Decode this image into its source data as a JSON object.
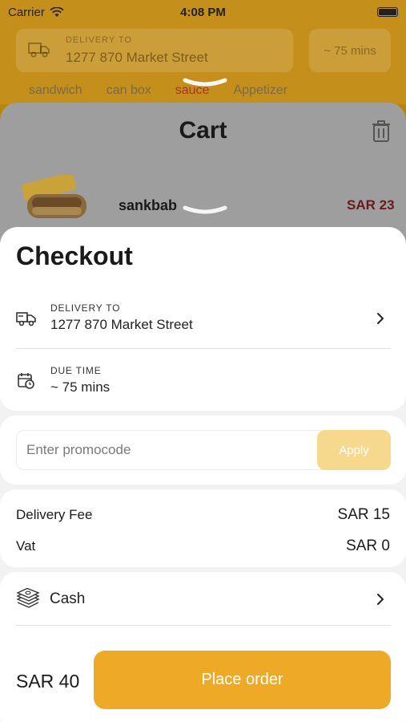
{
  "status_bar": {
    "carrier": "Carrier",
    "time": "4:08 PM"
  },
  "background_header": {
    "delivery_label": "DELIVERY TO",
    "delivery_address": "1277 870 Market Street",
    "time": "~ 75 mins",
    "categories": [
      "sandwich",
      "can box",
      "sauce",
      "Appetizer"
    ]
  },
  "cart": {
    "title": "Cart",
    "item": {
      "name": "sankbab",
      "price": "SAR 23"
    }
  },
  "checkout": {
    "title": "Checkout",
    "delivery": {
      "label": "DELIVERY TO",
      "value": "1277 870 Market Street"
    },
    "due_time": {
      "label": "DUE TIME",
      "value": "~ 75 mins"
    },
    "promo": {
      "placeholder": "Enter promocode",
      "apply_label": "Apply"
    },
    "fees": [
      {
        "label": "Delivery Fee",
        "value": "SAR 15"
      },
      {
        "label": "Vat",
        "value": "SAR 0"
      }
    ],
    "payment_method": "Cash",
    "total": "SAR 40",
    "place_order_label": "Place order"
  },
  "colors": {
    "accent": "#EEA926",
    "accent_light": "#F7D98E",
    "price_red": "#8B1A1A"
  }
}
